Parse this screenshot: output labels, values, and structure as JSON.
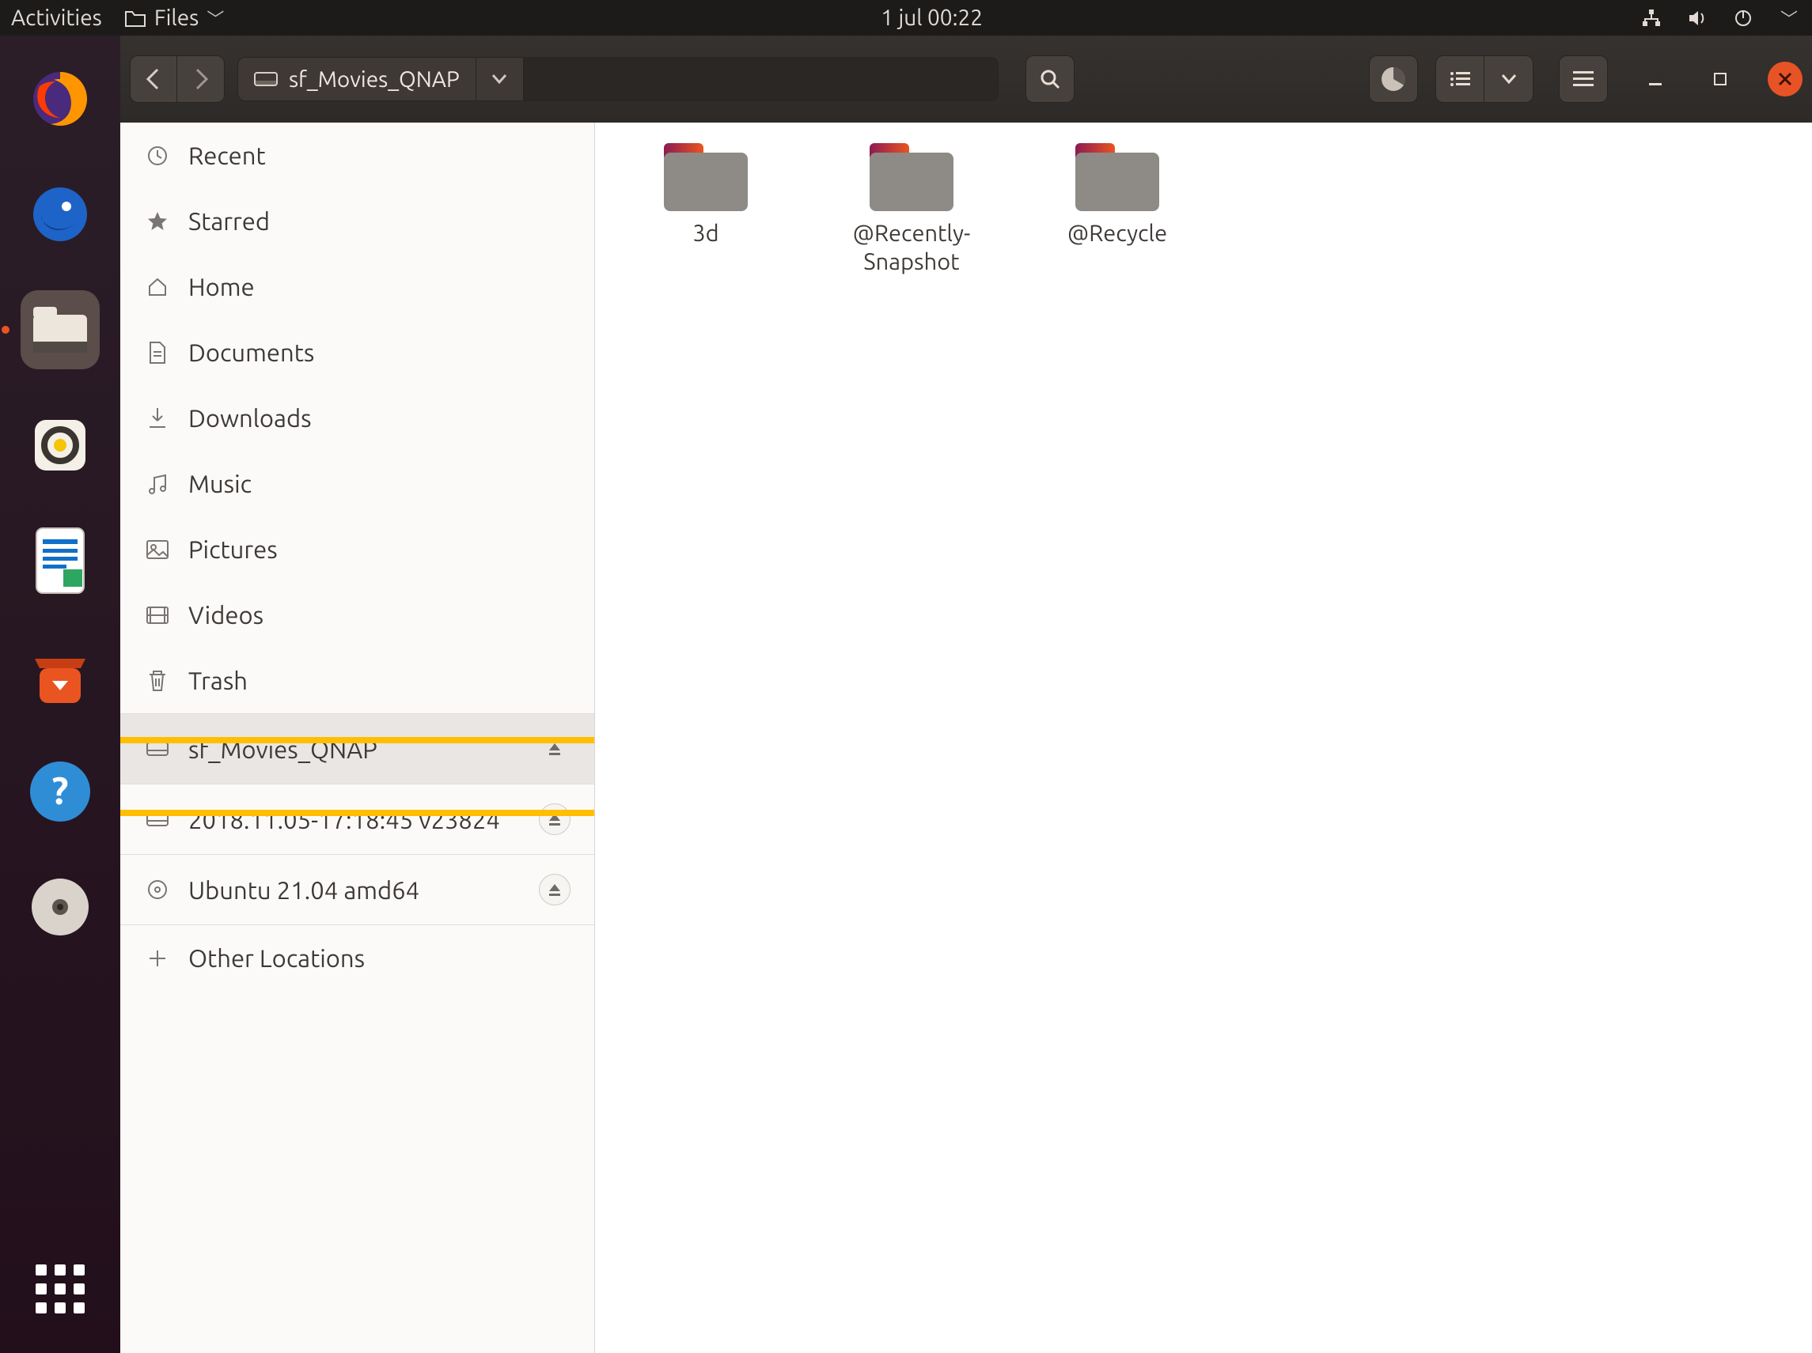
{
  "panel": {
    "activities": "Activities",
    "app_menu": "Files",
    "clock": "1 jul  00:22"
  },
  "headerbar": {
    "location": "sf_Movies_QNAP"
  },
  "sidebar": {
    "recent": "Recent",
    "starred": "Starred",
    "home": "Home",
    "documents": "Documents",
    "downloads": "Downloads",
    "music": "Music",
    "pictures": "Pictures",
    "videos": "Videos",
    "trash": "Trash",
    "sf_movies": "sf_Movies_QNAP",
    "snapshot": "2018.11.05-17:18:45 v23824",
    "ubuntu_iso": "Ubuntu 21.04 amd64",
    "other": "Other Locations"
  },
  "folders": [
    "3d",
    "@Recently-Snapshot",
    "@Recycle"
  ]
}
